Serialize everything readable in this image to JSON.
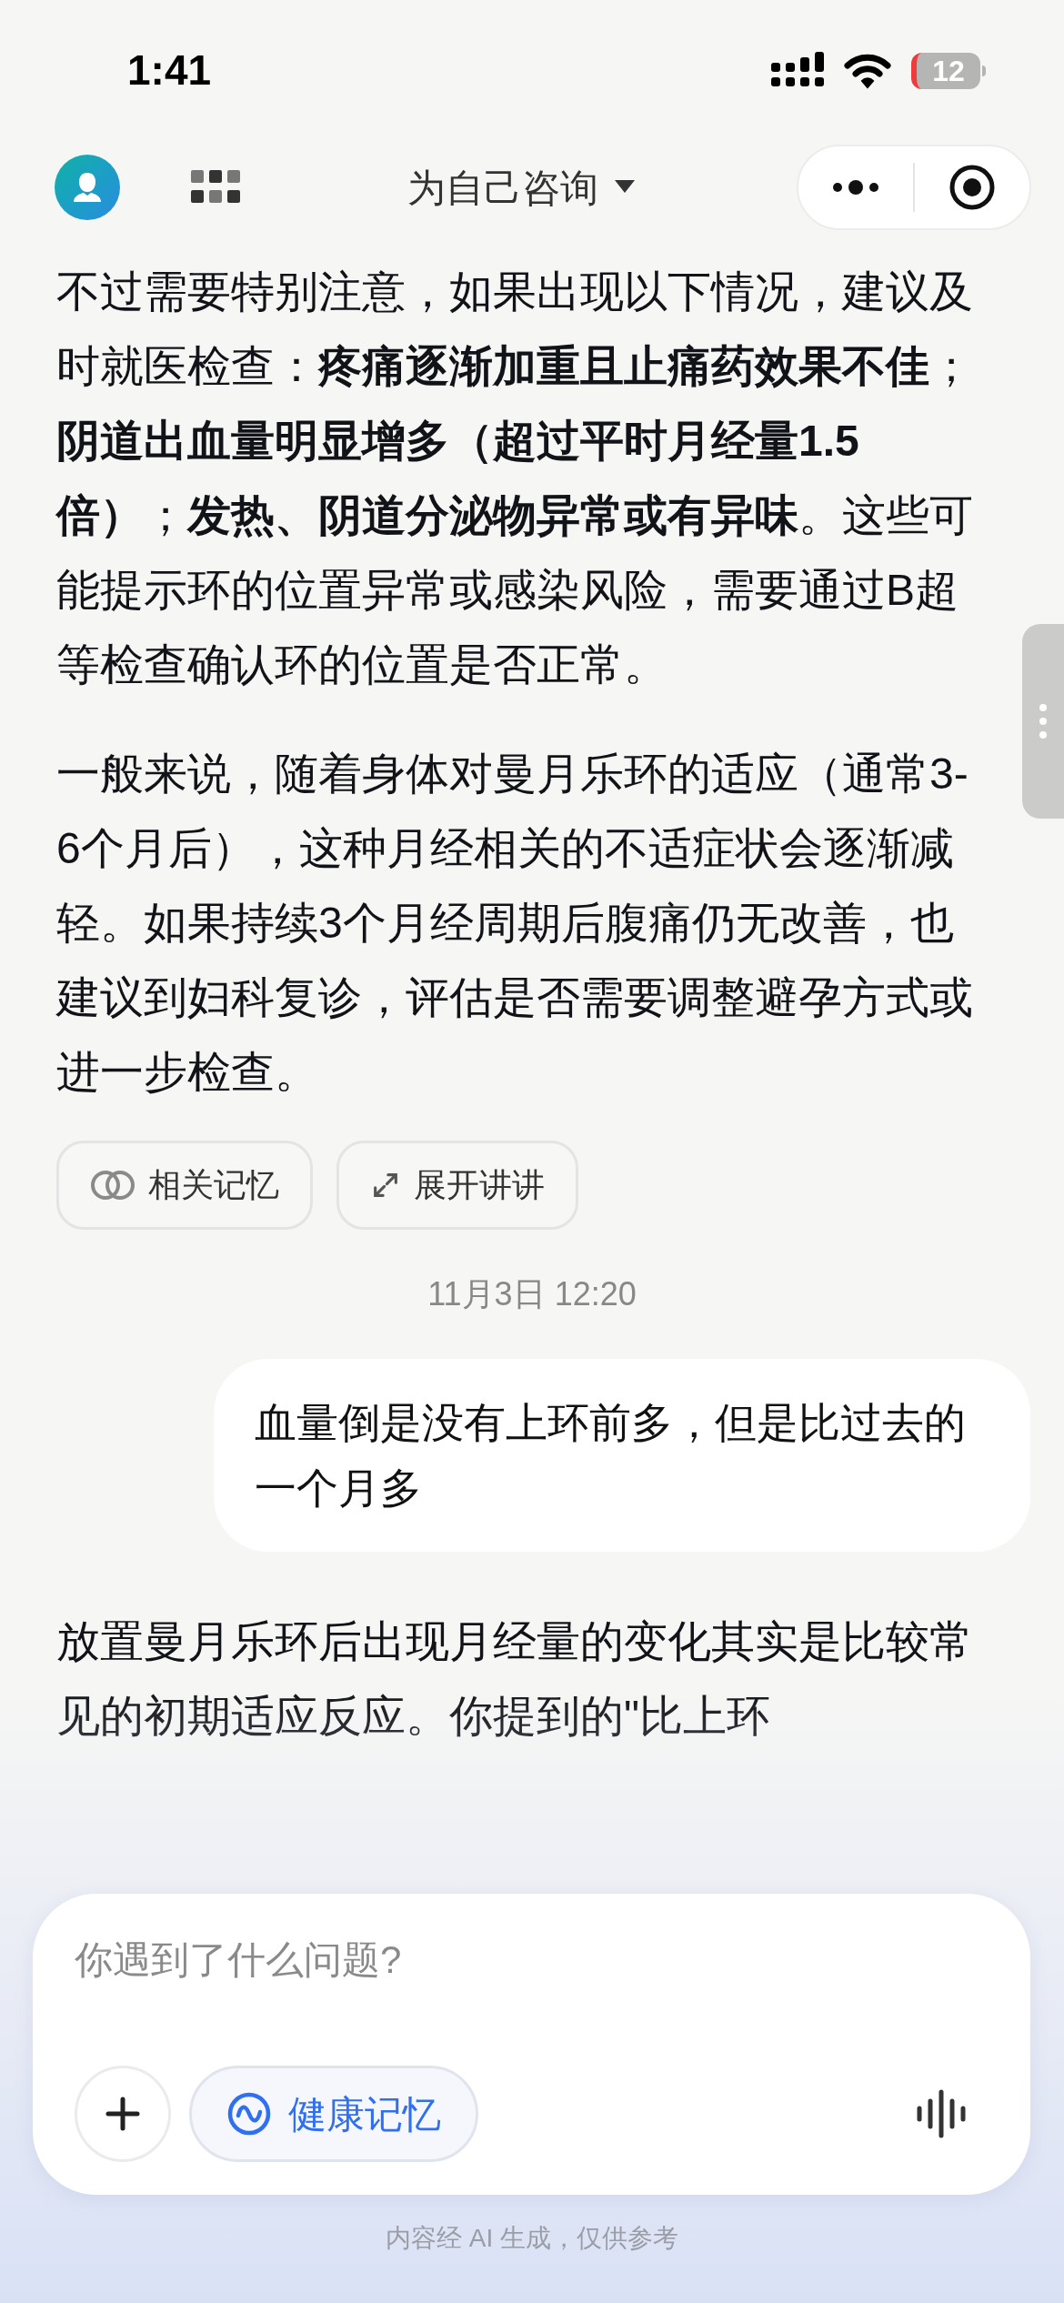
{
  "status_bar": {
    "time": "1:41",
    "battery": "12"
  },
  "nav": {
    "title": "为自己咨询"
  },
  "conversation": [
    {
      "kind": "assistant",
      "paragraphs": [
        "不过需要特别注意，如果出现以下情况，建议及时就医检查：**疼痛逐渐加重且止痛药效果不佳**；**阴道出血量明显增多（超过平时月经量1.5倍）**；**发热、阴道分泌物异常或有异味**。这些可能提示环的位置异常或感染风险，需要通过B超等检查确认环的位置是否正常。",
        "一般来说，随着身体对曼月乐环的适应（通常3-6个月后），这种月经相关的不适症状会逐渐减轻。如果持续3个月经周期后腹痛仍无改善，也建议到妇科复诊，评估是否需要调整避孕方式或进一步检查。"
      ]
    },
    {
      "kind": "actions",
      "buttons": [
        {
          "kind": "memory",
          "label": "相关记忆"
        },
        {
          "kind": "expand",
          "label": "展开讲讲"
        }
      ]
    },
    {
      "kind": "timestamp",
      "text": "11月3日 12:20"
    },
    {
      "kind": "user",
      "text": "血量倒是没有上环前多，但是比过去的一个月多"
    },
    {
      "kind": "assistant",
      "paragraphs": [
        "放置曼月乐环后出现月经量的变化其实是比较常见的初期适应反应。你提到的\"比上环"
      ]
    }
  ],
  "composer": {
    "placeholder": "你遇到了什么问题?",
    "chip": "健康记忆",
    "note": "内容经 AI 生成，仅供参考"
  }
}
